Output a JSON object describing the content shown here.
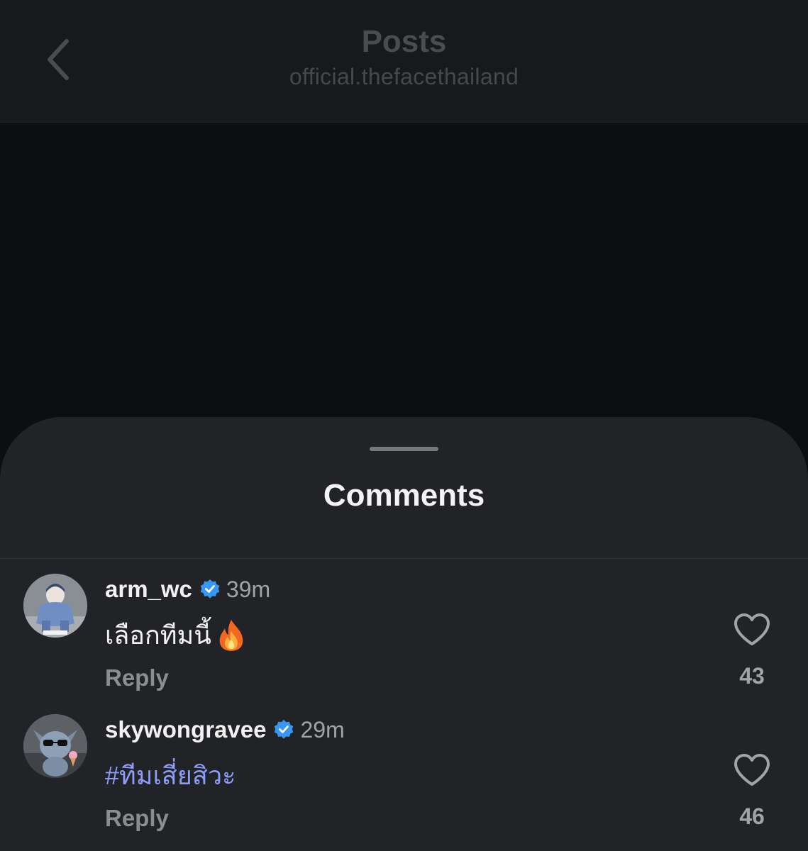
{
  "header": {
    "title": "Posts",
    "subtitle": "official.thefacethailand",
    "back_icon": "chevron-left-icon"
  },
  "comments_sheet": {
    "title": "Comments",
    "comments": [
      {
        "username": "arm_wc",
        "verified": true,
        "time": "39m",
        "text": "เลือกทีมนี้",
        "emoji": "fire-emoji",
        "is_hashtag": false,
        "reply_label": "Reply",
        "like_count": "43"
      },
      {
        "username": "skywongravee",
        "verified": true,
        "time": "29m",
        "text": "#ทีมเสี่ยสิวะ",
        "is_hashtag": true,
        "reply_label": "Reply",
        "like_count": "46"
      }
    ]
  },
  "colors": {
    "sheet_background": "#212327",
    "verified_badge": "#3897f0",
    "hashtag": "#8c9cf7"
  }
}
